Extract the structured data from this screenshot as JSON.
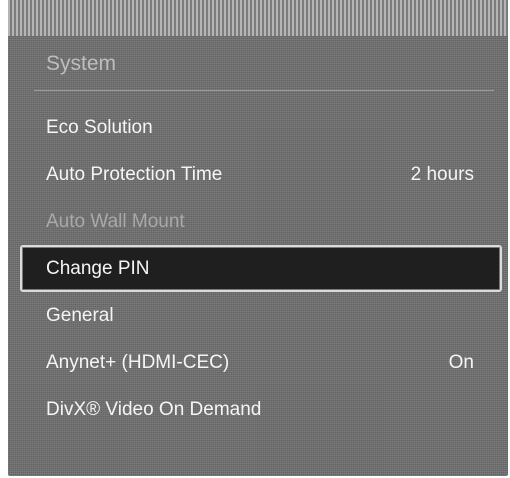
{
  "menu": {
    "title": "System",
    "items": [
      {
        "label": "Eco Solution",
        "value": ""
      },
      {
        "label": "Auto Protection Time",
        "value": "2 hours"
      },
      {
        "label": "Auto Wall Mount",
        "value": ""
      },
      {
        "label": "Change PIN",
        "value": ""
      },
      {
        "label": "General",
        "value": ""
      },
      {
        "label": "Anynet+ (HDMI-CEC)",
        "value": "On"
      },
      {
        "label": "DivX® Video On Demand",
        "value": ""
      }
    ],
    "selected_index": 3,
    "disabled_index": 2
  }
}
